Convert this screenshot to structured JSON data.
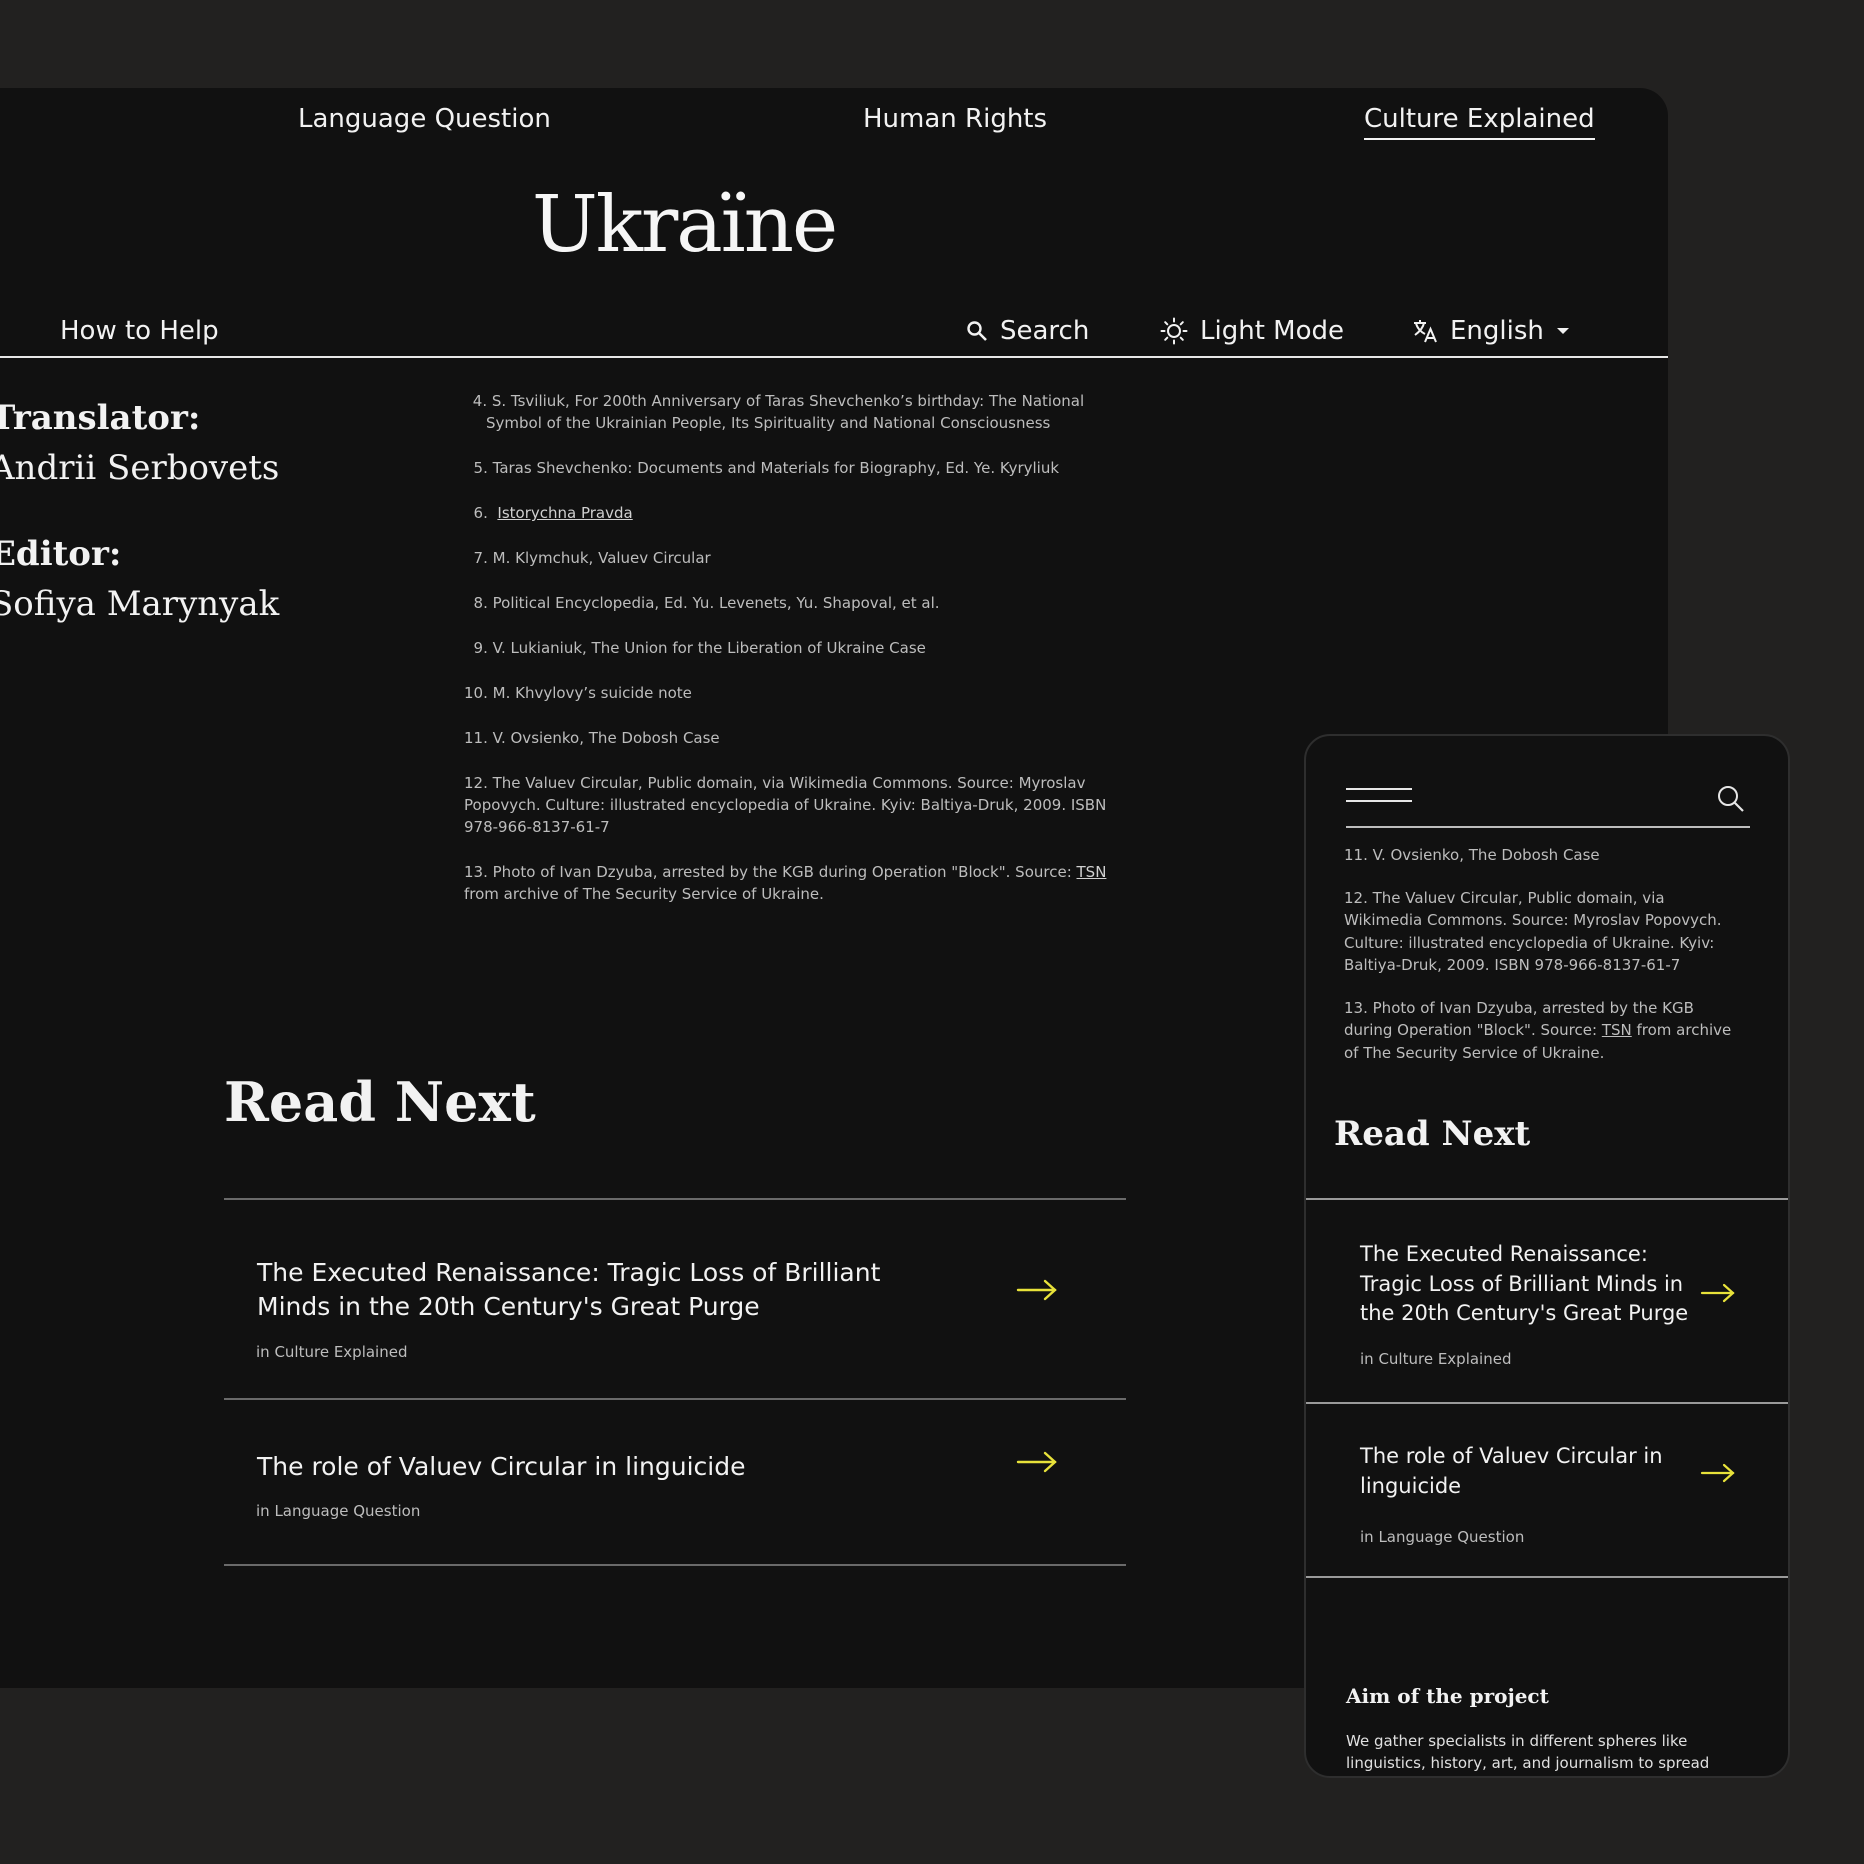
{
  "top_nav": {
    "language_question": "Language Question",
    "human_rights": "Human Rights",
    "culture_explained": "Culture Explained"
  },
  "logo": "Ukraїne",
  "secondary_nav": {
    "how_to_help": "How to Help",
    "search": "Search",
    "light_mode": "Light Mode",
    "language": "English"
  },
  "credits": {
    "translator_label": "Translator:",
    "translator_name": "Andrii Serbovets",
    "editor_label": "Editor:",
    "editor_name": "Sofiya Marynyak"
  },
  "references": [
    {
      "num": "4.",
      "text": "S. Tsviliuk, For 200th Anniversary of Taras Shevchenko’s birthday: The National Symbol of the Ukrainian People, Its Spirituality and National Consciousness"
    },
    {
      "num": "5.",
      "text": "Taras Shevchenko: Documents and Materials for Biography, Ed. Ye. Kyryliuk"
    },
    {
      "num": "6.",
      "link": "Istorychna Pravda"
    },
    {
      "num": "7.",
      "text": "M. Klymchuk, Valuev Circular"
    },
    {
      "num": "8.",
      "text": "Political Encyclopedia, Ed. Yu. Levenets, Yu. Shapoval, et al."
    },
    {
      "num": "9.",
      "text": "V. Lukianiuk, The Union for the Liberation of Ukraine Case"
    },
    {
      "num": "10.",
      "text": "M. Khvylovy’s suicide note"
    },
    {
      "num": "11.",
      "text": "V. Ovsienko, The Dobosh Case"
    },
    {
      "num": "12.",
      "text": "The Valuev Circular, Public domain, via Wikimedia Commons. Source: Myroslav Popovych. Culture: illustrated encyclopedia of Ukraine. Kyiv: Baltiya-Druk, 2009. ISBN 978-966-8137-61-7"
    },
    {
      "num": "13.",
      "text_before": "Photo of Ivan Dzyuba, arrested by the KGB during Operation \"Block\". Source: ",
      "link": "TSN",
      "text_after": " from archive of The Security Service of Ukraine."
    }
  ],
  "read_next": {
    "title": "Read Next",
    "items": [
      {
        "title": "The Executed Renaissance: Tragic Loss of Brilliant Minds in the 20th Century's Great Purge",
        "section": "in Culture Explained"
      },
      {
        "title": "The role of Valuev Circular in linguicide",
        "section": "in Language Question"
      }
    ]
  },
  "mobile": {
    "aim_title": "Aim of the project",
    "aim_text": "We gather specialists in different spheres like linguistics, history, art, and journalism to spread"
  },
  "colors": {
    "background": "#222120",
    "panel": "#111111",
    "accent_arrow": "#e8e23a"
  }
}
